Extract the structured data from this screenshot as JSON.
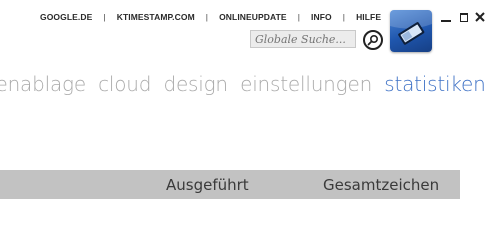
{
  "top_links": [
    "GOOGLE.DE",
    "KTIMESTAMP.COM",
    "ONLINEUPDATE",
    "INFO",
    "HILFE"
  ],
  "search": {
    "placeholder": "Globale Suche..."
  },
  "icons": {
    "search": "magnifier-icon",
    "app": "app-logo-icon",
    "minimize": "minimize-icon",
    "maximize": "maximize-icon",
    "close": "close-icon"
  },
  "nav_tabs": [
    {
      "label": "nenablage"
    },
    {
      "label": "cloud"
    },
    {
      "label": "design"
    },
    {
      "label": "einstellungen"
    },
    {
      "label": "statistiken",
      "active": true
    }
  ],
  "table": {
    "columns": [
      "Ausgeführt",
      "Gesamtzeichen"
    ]
  },
  "colors": {
    "accent": "#3f72c6",
    "tab_inactive": "#aaaaaa",
    "header_bg": "#c2c2c2",
    "icon_blue": "#2b62b8"
  }
}
